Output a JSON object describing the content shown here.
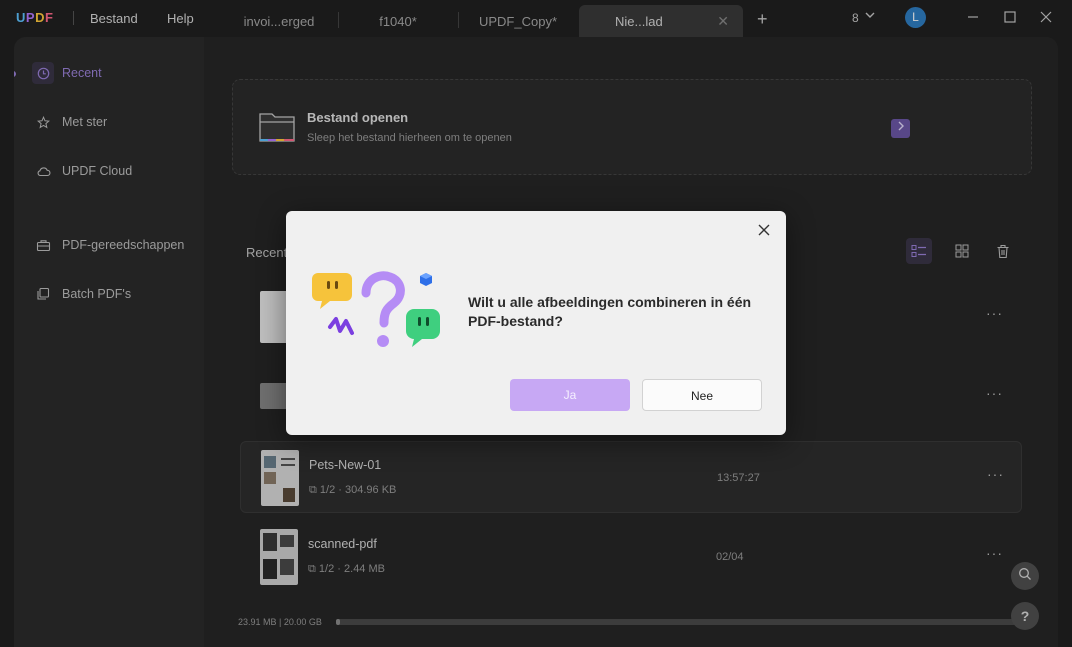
{
  "titlebar": {
    "logo": {
      "u": "U",
      "p": "P",
      "d": "D",
      "f": "F"
    },
    "menus": [
      "Bestand",
      "Help"
    ],
    "tabs": [
      "invoi...erged",
      "f1040*",
      "UPDF_Copy*",
      "Nie...lad"
    ],
    "tab_close": "✕",
    "new_tab": "+",
    "count": "8",
    "avatar_letter": "L"
  },
  "sidebar": {
    "items": [
      "Recent",
      "Met ster",
      "UPDF Cloud",
      "PDF-gereedschappen",
      "Batch PDF's"
    ]
  },
  "open": {
    "title": "Bestand openen",
    "subtitle": "Sleep het bestand hierheen om te openen"
  },
  "recent": {
    "title": "Recent",
    "files": [
      {
        "name": "Pets-New-01",
        "pages": "1/2",
        "size": "304.96 KB",
        "time": "13:57:27"
      },
      {
        "name": "scanned-pdf",
        "pages": "1/2",
        "size": "2.44 MB",
        "time": "02/04"
      }
    ]
  },
  "storage": {
    "label": "23.91 MB | 20.00 GB",
    "used_fraction": 0.0012
  },
  "dialog": {
    "message": "Wilt u alle afbeeldingen combineren in één PDF-bestand?",
    "yes": "Ja",
    "no": "Nee",
    "close": "✕"
  },
  "colors": {
    "accent": "#9b82d8",
    "yes_button": "#c7a8f4"
  },
  "icons": [
    "clock-icon",
    "star-icon",
    "cloud-icon",
    "toolbox-icon",
    "batch-icon",
    "folder-icon",
    "list-view-icon",
    "grid-view-icon",
    "trash-icon",
    "more-icon",
    "search-icon",
    "help-icon",
    "close-icon"
  ]
}
